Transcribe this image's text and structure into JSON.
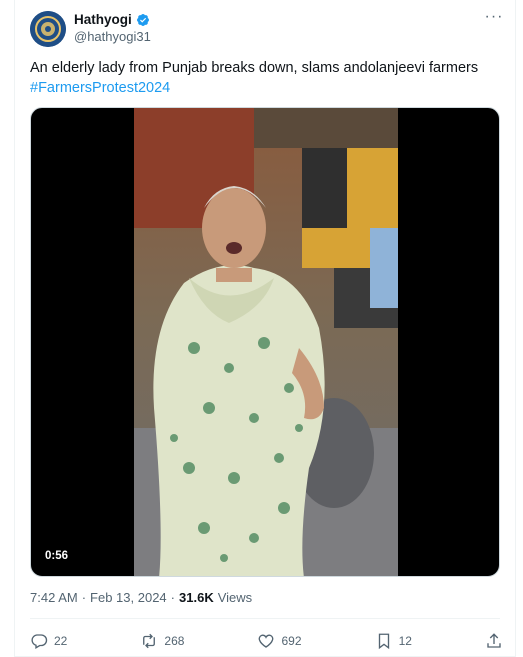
{
  "author": {
    "name": "Hathyogi",
    "handle": "@hathyogi31",
    "verified": true,
    "avatar_color": "#1f4e86"
  },
  "more_icon": "ellipsis-icon",
  "tweet": {
    "text": "An elderly lady from Punjab breaks down, slams andolanjeevi farmers",
    "hashtag": "#FarmersProtest2024"
  },
  "media": {
    "type": "video",
    "duration": "0:56"
  },
  "meta": {
    "time": "7:42 AM",
    "separator": "·",
    "date": "Feb 13, 2024",
    "views_count": "31.6K",
    "views_label": "Views"
  },
  "actions": {
    "reply": {
      "icon": "reply-icon",
      "count": "22"
    },
    "retweet": {
      "icon": "retweet-icon",
      "count": "268"
    },
    "like": {
      "icon": "heart-icon",
      "count": "692"
    },
    "bookmark": {
      "icon": "bookmark-icon",
      "count": "12"
    },
    "share": {
      "icon": "share-icon",
      "count": ""
    }
  },
  "colors": {
    "link": "#1d9bf0",
    "secondary_text": "#536471",
    "primary_text": "#0f1419"
  }
}
